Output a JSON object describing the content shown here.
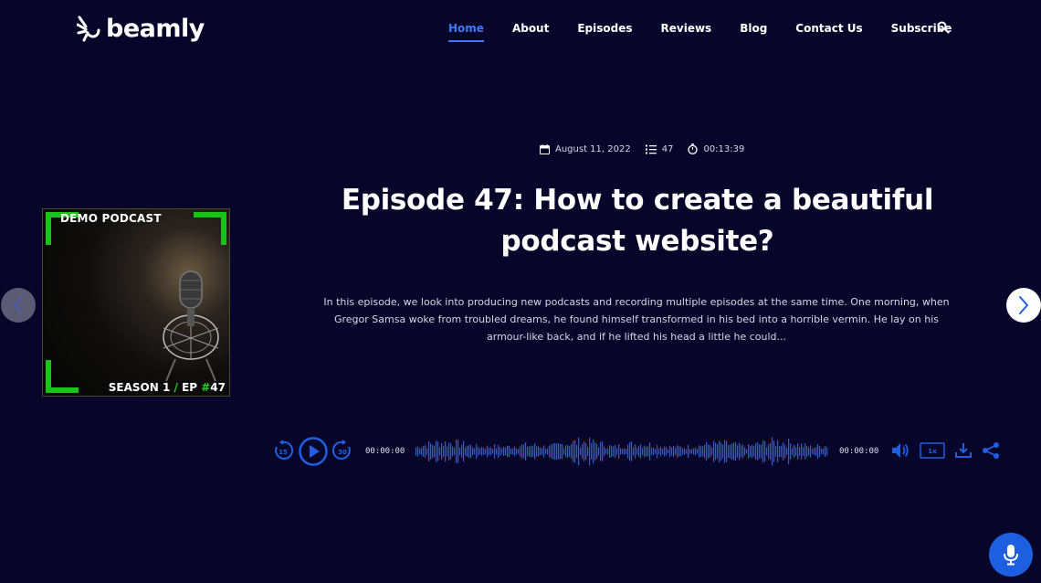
{
  "brand": {
    "name": "beamly"
  },
  "nav": {
    "items": [
      {
        "label": "Home",
        "active": true
      },
      {
        "label": "About"
      },
      {
        "label": "Episodes"
      },
      {
        "label": "Reviews"
      },
      {
        "label": "Blog"
      },
      {
        "label": "Contact Us"
      },
      {
        "label": "Subscribe"
      }
    ],
    "search_icon": "search-icon"
  },
  "episode": {
    "date": "August 11, 2022",
    "number": "47",
    "duration": "00:13:39",
    "title": "Episode 47: How to create a beautiful podcast website?",
    "description": "In this episode, we look into producing new podcasts and recording multiple episodes at the same time. One morning, when Gregor Samsa woke from troubled dreams, he found himself transformed in his bed into a horrible vermin. He lay on his armour-like back, and if he lifted his head a little he could..."
  },
  "cover": {
    "top_label": "DEMO PODCAST",
    "season": "SEASON 1",
    "separator": "/",
    "ep_prefix": "EP ",
    "ep_hash": "#",
    "ep_number": "47"
  },
  "player": {
    "current_time": "00:00:00",
    "total_time": "00:00:00",
    "rewind_seconds": "15",
    "forward_seconds": "30",
    "speed": "1x"
  },
  "colors": {
    "background": "#07062a",
    "accent": "#3d79ff",
    "player_blue": "#1f5fe0",
    "cover_green": "#19c419"
  }
}
